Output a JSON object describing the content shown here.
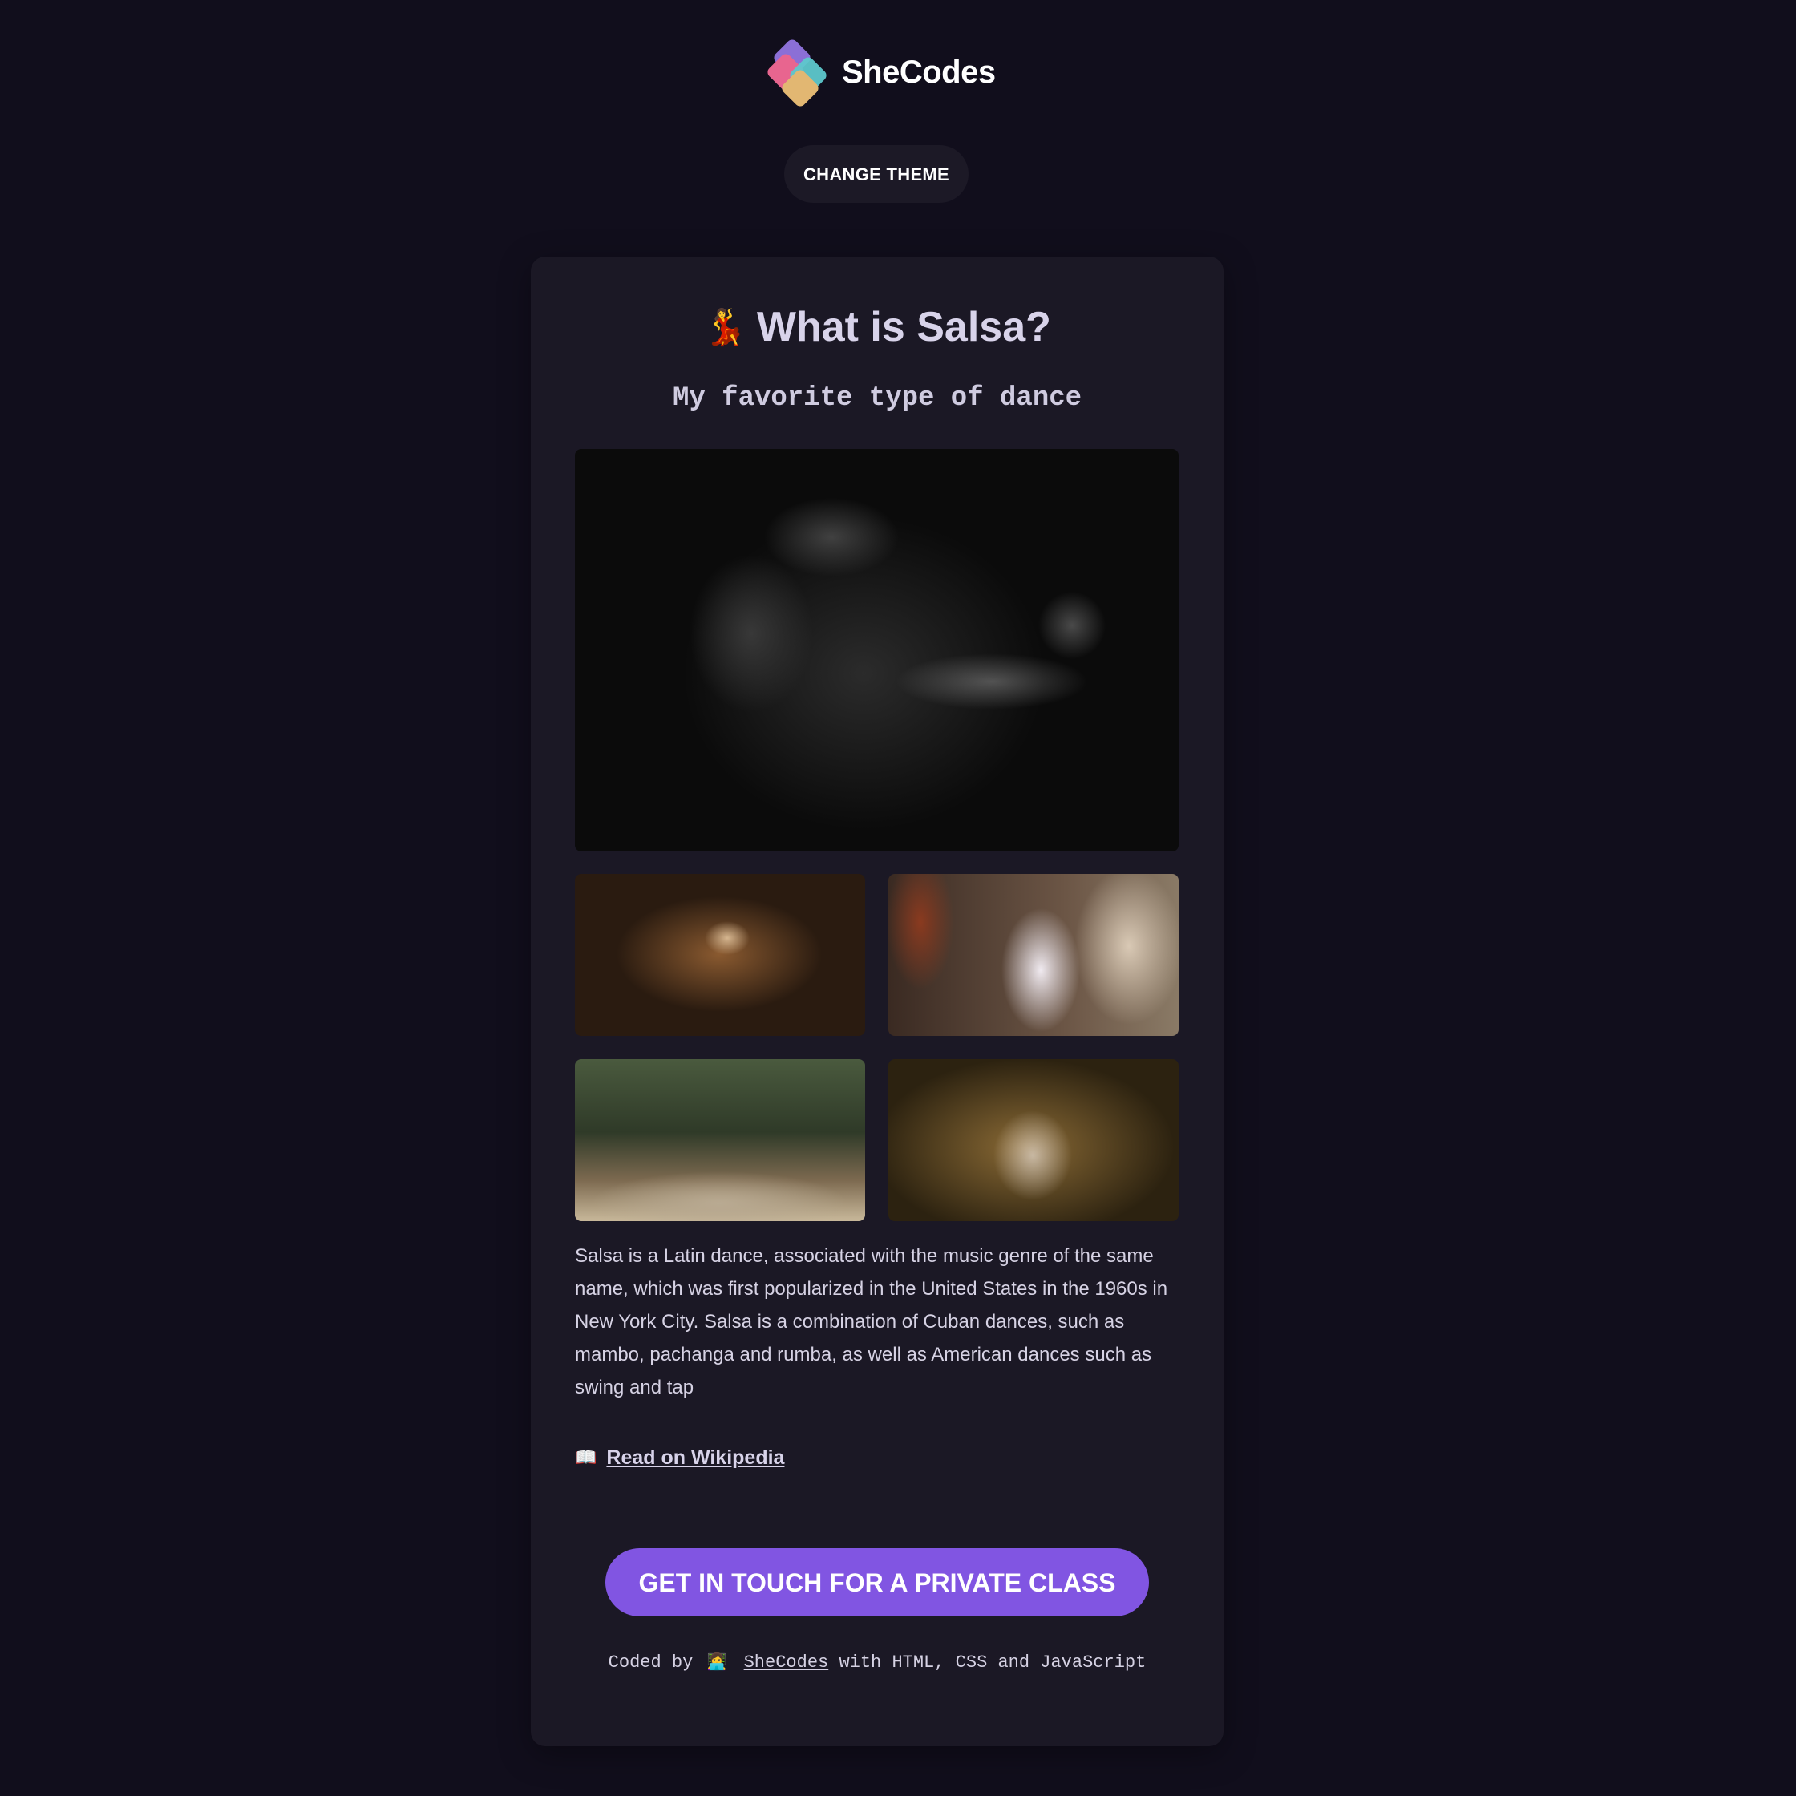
{
  "header": {
    "logo_text": "SheCodes",
    "logo_icon": "shecodes-diamond-logo",
    "theme_button_label": "CHANGE THEME"
  },
  "card": {
    "title_emoji": "💃",
    "title": "What is Salsa?",
    "subtitle": "My favorite type of dance",
    "description": "Salsa is a Latin dance, associated with the music genre of the same name, which was first popularized in the United States in the 1960s in New York City. Salsa is a combination of Cuban dances, such as mambo, pachanga and rumba, as well as American dances such as swing and tap",
    "wiki_icon": "📖",
    "wiki_link": "Read on Wikipedia",
    "cta_label": "GET IN TOUCH FOR A PRIVATE CLASS",
    "footer": {
      "prefix": "Coded by",
      "icon": "👩‍💻",
      "link": "SheCodes",
      "suffix": "with HTML, CSS and JavaScript"
    }
  },
  "colors": {
    "background": "#110e1c",
    "card": "#1b1825",
    "accent": "#8155e2",
    "theme_button": "#1c1926"
  }
}
